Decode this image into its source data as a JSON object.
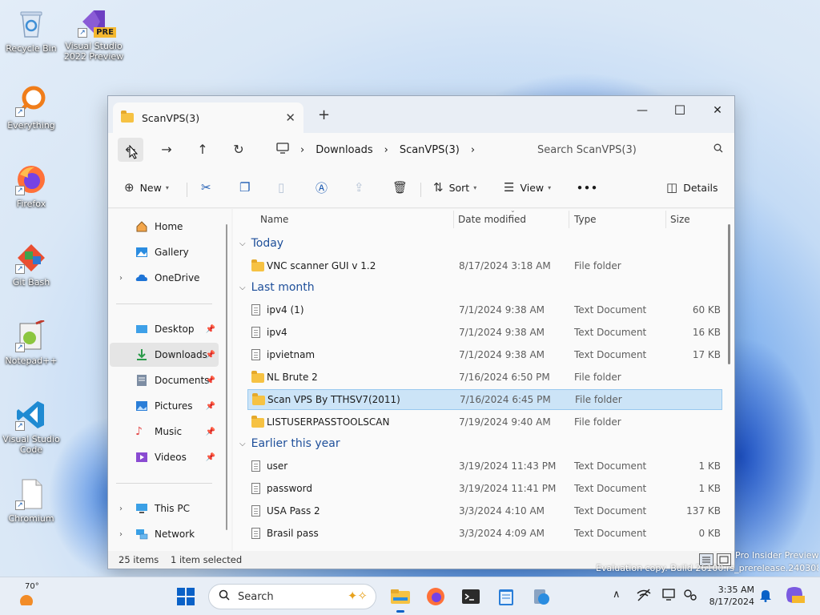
{
  "desktop": {
    "icons": [
      {
        "label_line1": "Recycle Bin",
        "label_line2": ""
      },
      {
        "label_line1": "Visual Studio",
        "label_line2": "2022 Preview",
        "badge": "PRE"
      },
      {
        "label_line1": "Everything",
        "label_line2": ""
      },
      {
        "label_line1": "Firefox",
        "label_line2": ""
      },
      {
        "label_line1": "Git Bash",
        "label_line2": ""
      },
      {
        "label_line1": "Notepad++",
        "label_line2": ""
      },
      {
        "label_line1": "Visual Studio",
        "label_line2": "Code"
      },
      {
        "label_line1": "Chromium",
        "label_line2": ""
      }
    ],
    "watermark_line1": "Pro Insider Preview",
    "watermark_line2": "Evaluation copy. Build 26100.rs_prerelease.240308-1400"
  },
  "window": {
    "tab_title": "ScanVPS(3)",
    "tab_close": "✕",
    "new_tab": "+",
    "minimize": "—",
    "maximize": "☐",
    "close": "✕",
    "nav": {
      "back": "←",
      "forward": "→",
      "up": "↑",
      "refresh": "↻"
    },
    "breadcrumb": {
      "sep": "›",
      "items": [
        "Downloads",
        "ScanVPS(3)"
      ]
    },
    "search_placeholder": "Search ScanVPS(3)",
    "toolbar": {
      "new_label": "New",
      "sort_label": "Sort",
      "view_label": "View",
      "more_label": "•••",
      "details_label": "Details"
    },
    "sidebar": {
      "items": [
        {
          "label": "Home"
        },
        {
          "label": "Gallery"
        },
        {
          "label": "OneDrive"
        },
        {
          "label": "Desktop"
        },
        {
          "label": "Downloads"
        },
        {
          "label": "Documents"
        },
        {
          "label": "Pictures"
        },
        {
          "label": "Music"
        },
        {
          "label": "Videos"
        },
        {
          "label": "This PC"
        },
        {
          "label": "Network"
        }
      ]
    },
    "columns": {
      "name": "Name",
      "date": "Date modified",
      "type": "Type",
      "size": "Size"
    },
    "groups": [
      "Today",
      "Last month",
      "Earlier this year"
    ],
    "files": [
      {
        "name": "VNC scanner GUI v 1.2",
        "date": "8/17/2024 3:18 AM",
        "type": "File folder",
        "size": ""
      },
      {
        "name": "ipv4 (1)",
        "date": "7/1/2024 9:38 AM",
        "type": "Text Document",
        "size": "60 KB"
      },
      {
        "name": "ipv4",
        "date": "7/1/2024 9:38 AM",
        "type": "Text Document",
        "size": "16 KB"
      },
      {
        "name": "ipvietnam",
        "date": "7/1/2024 9:38 AM",
        "type": "Text Document",
        "size": "17 KB"
      },
      {
        "name": "NL Brute 2",
        "date": "7/16/2024 6:50 PM",
        "type": "File folder",
        "size": ""
      },
      {
        "name": "Scan VPS By TTHSV7(2011)",
        "date": "7/16/2024 6:45 PM",
        "type": "File folder",
        "size": ""
      },
      {
        "name": "LISTUSERPASSTOOLSCAN",
        "date": "7/19/2024 9:40 AM",
        "type": "File folder",
        "size": ""
      },
      {
        "name": "user",
        "date": "3/19/2024 11:43 PM",
        "type": "Text Document",
        "size": "1 KB"
      },
      {
        "name": "password",
        "date": "3/19/2024 11:41 PM",
        "type": "Text Document",
        "size": "1 KB"
      },
      {
        "name": "USA Pass 2",
        "date": "3/3/2024 4:10 AM",
        "type": "Text Document",
        "size": "137 KB"
      },
      {
        "name": "Brasil pass",
        "date": "3/3/2024 4:09 AM",
        "type": "Text Document",
        "size": "0 KB"
      }
    ],
    "status": {
      "count": "25 items",
      "selected": "1 item selected"
    }
  },
  "taskbar": {
    "weather_temp": "70°",
    "search_label": "Search",
    "time": "3:35 AM",
    "date": "8/17/2024",
    "tray_chevron": "∧"
  },
  "colors": {
    "accent": "#0a61c7",
    "selection": "#cce4f7",
    "folder": "#f6c243"
  }
}
